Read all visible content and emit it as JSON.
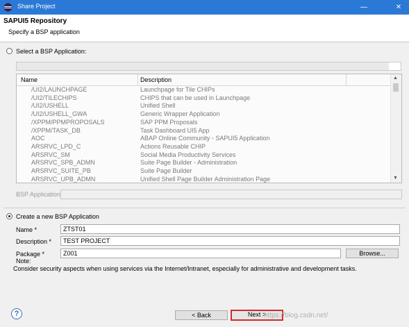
{
  "window": {
    "title": "Share Project",
    "minimize_symbol": "—",
    "close_symbol": "✕"
  },
  "header": {
    "title": "SAPUI5 Repository",
    "subtitle": "Specify a BSP application"
  },
  "select_existing": {
    "label": "Select a BSP Application:",
    "table": {
      "columns": [
        "Name",
        "Description"
      ],
      "rows": [
        {
          "name": "/UI2/LAUNCHPAGE",
          "description": "Launchpage for Tile CHIPs"
        },
        {
          "name": "/UI2/TILECHIPS",
          "description": "CHIPS that can be used in Launchpage"
        },
        {
          "name": "/UI2/USHELL",
          "description": "Unified Shell"
        },
        {
          "name": "/UI2/USHELL_GWA",
          "description": "Generic Wrapper Application"
        },
        {
          "name": "/XPPM/PPMPROPOSALS",
          "description": "SAP PPM Proposals"
        },
        {
          "name": "/XPPM/TASK_DB",
          "description": "Task Dashboard UI5 App"
        },
        {
          "name": "AOC",
          "description": "ABAP Online Community - SAPUI5 Application"
        },
        {
          "name": "ARSRVC_LPD_C",
          "description": "Actions Reusable CHIP"
        },
        {
          "name": "ARSRVC_SM",
          "description": "Social Media Productivity Services"
        },
        {
          "name": "ARSRVC_SPB_ADMN",
          "description": "Suite Page Builder - Administration"
        },
        {
          "name": "ARSRVC_SUITE_PB",
          "description": "Suite Page Builder"
        },
        {
          "name": "ARSRVC_UPB_ADMN",
          "description": "Unified Shell Page Builder Administration Page"
        }
      ]
    },
    "bsp_application_label": "BSP Application:"
  },
  "create_new": {
    "label": "Create a new BSP Application",
    "name_label": "Name *",
    "name_value": "ZTST01",
    "description_label": "Description *",
    "description_value": "TEST PROJECT",
    "package_label": "Package *",
    "package_value": "Z001",
    "browse_label": "Browse..."
  },
  "note": {
    "title": "Note:",
    "text": "Consider security aspects when using services via the Internet/Intranet, especially for administrative and development tasks."
  },
  "footer": {
    "back_label": "< Back",
    "next_label": "Next >",
    "watermark": "https://blog.csdn.net/"
  }
}
